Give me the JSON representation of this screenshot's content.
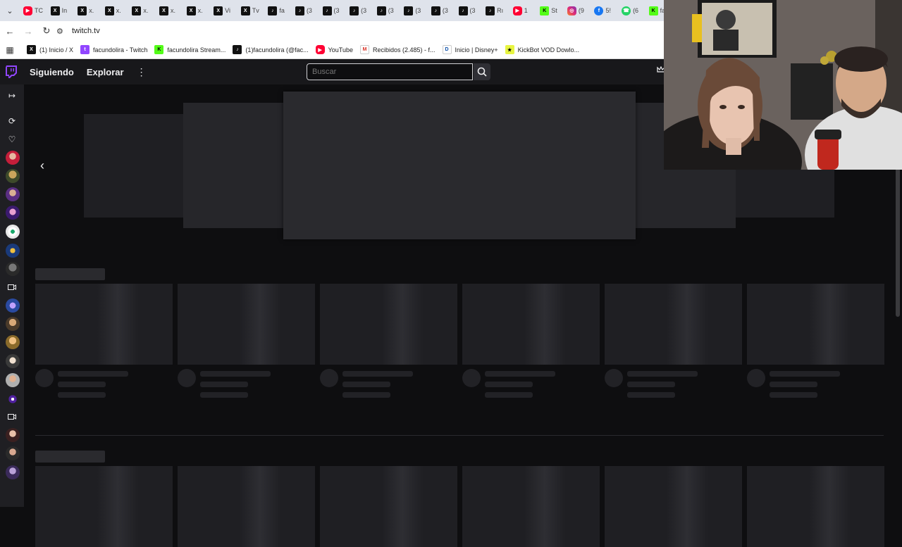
{
  "browser": {
    "tabs": [
      {
        "icon": "youtube-icon",
        "label": "TC"
      },
      {
        "icon": "x-icon",
        "label": "In"
      },
      {
        "icon": "x-icon",
        "label": "x."
      },
      {
        "icon": "x-icon",
        "label": "x."
      },
      {
        "icon": "x-icon",
        "label": "x."
      },
      {
        "icon": "x-icon",
        "label": "x."
      },
      {
        "icon": "x-icon",
        "label": "x."
      },
      {
        "icon": "x-icon",
        "label": "Vi"
      },
      {
        "icon": "x-icon",
        "label": "Tv"
      },
      {
        "icon": "tiktok-icon",
        "label": "fa"
      },
      {
        "icon": "tiktok-icon",
        "label": "(3"
      },
      {
        "icon": "tiktok-icon",
        "label": "(3"
      },
      {
        "icon": "tiktok-icon",
        "label": "(3"
      },
      {
        "icon": "tiktok-icon",
        "label": "(3"
      },
      {
        "icon": "tiktok-icon",
        "label": "(3"
      },
      {
        "icon": "tiktok-icon",
        "label": "(3"
      },
      {
        "icon": "tiktok-icon",
        "label": "(3"
      },
      {
        "icon": "tiktok-icon",
        "label": "Rı"
      },
      {
        "icon": "youtube-icon",
        "label": "1"
      },
      {
        "icon": "kick-icon",
        "label": "St"
      },
      {
        "icon": "instagram-icon",
        "label": "(9"
      },
      {
        "icon": "facebook-icon",
        "label": "5!"
      },
      {
        "icon": "whatsapp-icon",
        "label": "(6"
      },
      {
        "icon": "kick-icon",
        "label": "fa"
      }
    ],
    "url": "twitch.tv",
    "bookmarks": [
      {
        "icon": "x-icon",
        "label": "(1) Inicio / X"
      },
      {
        "icon": "twitch-icon",
        "label": "facundolira - Twitch"
      },
      {
        "icon": "kick-icon",
        "label": "facundolira Stream..."
      },
      {
        "icon": "tiktok-icon",
        "label": "(1)facundolira (@fac..."
      },
      {
        "icon": "youtube-icon",
        "label": "YouTube"
      },
      {
        "icon": "gmail-icon",
        "label": "Recibidos (2.485) - f..."
      },
      {
        "icon": "disney-icon",
        "label": "Inicio | Disney+"
      },
      {
        "icon": "kickbot-icon",
        "label": "KickBot VOD Dowlo..."
      }
    ]
  },
  "twitch": {
    "nav": {
      "following": "Siguiendo",
      "browse": "Explorar"
    },
    "search": {
      "placeholder": "Buscar"
    }
  }
}
